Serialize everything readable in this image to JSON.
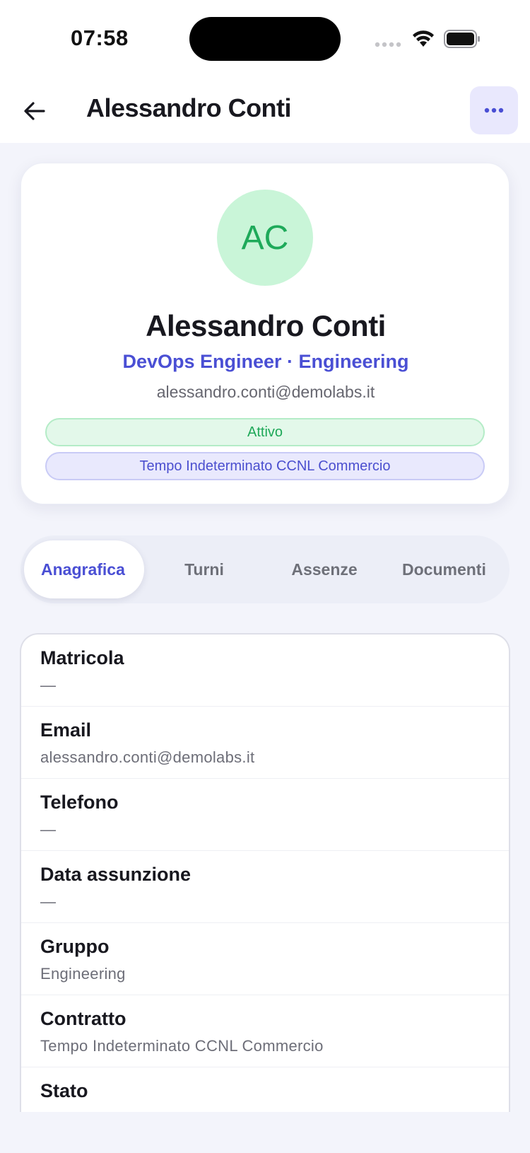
{
  "status_bar": {
    "time": "07:58"
  },
  "header": {
    "title": "Alessandro Conti",
    "back_icon": "arrow-left-icon",
    "more_icon": "ellipsis-icon"
  },
  "profile": {
    "initials": "AC",
    "name": "Alessandro Conti",
    "role": "DevOps Engineer · Engineering",
    "email": "alessandro.conti@demolabs.it",
    "status": "Attivo",
    "contract": "Tempo Indeterminato CCNL Commercio"
  },
  "tabs": [
    {
      "label": "Anagrafica",
      "active": true
    },
    {
      "label": "Turni",
      "active": false
    },
    {
      "label": "Assenze",
      "active": false
    },
    {
      "label": "Documenti",
      "active": false
    }
  ],
  "details": [
    {
      "label": "Matricola",
      "value": "—"
    },
    {
      "label": "Email",
      "value": "alessandro.conti@demolabs.it"
    },
    {
      "label": "Telefono",
      "value": "—"
    },
    {
      "label": "Data assunzione",
      "value": "—"
    },
    {
      "label": "Gruppo",
      "value": "Engineering"
    },
    {
      "label": "Contratto",
      "value": "Tempo Indeterminato CCNL Commercio"
    },
    {
      "label": "Stato",
      "value": ""
    }
  ],
  "colors": {
    "accent": "#4a4fd4",
    "success": "#1ea858",
    "avatar_bg": "#c9f5d8",
    "background": "#f3f4fb"
  }
}
